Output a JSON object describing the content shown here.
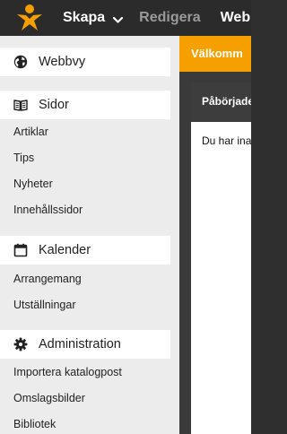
{
  "topbar": {
    "logo_icon": "person-star-logo-icon",
    "create_label": "Skapa",
    "create_icon": "chevron-down-icon",
    "edit_label": "Redigera",
    "web_label": "Webb",
    "logo_color": "#f5a000"
  },
  "sidebar": {
    "sections": [
      {
        "title": "Webbvy",
        "icon": "globe-icon",
        "items": []
      },
      {
        "title": "Sidor",
        "icon": "open-book-icon",
        "items": [
          {
            "label": "Artiklar"
          },
          {
            "label": "Tips"
          },
          {
            "label": "Nyheter"
          },
          {
            "label": "Innehållssidor"
          }
        ]
      },
      {
        "title": "Kalender",
        "icon": "calendar-icon",
        "items": [
          {
            "label": "Arrangemang"
          },
          {
            "label": "Utställningar"
          }
        ]
      },
      {
        "title": "Administration",
        "icon": "gear-icon",
        "items": [
          {
            "label": "Importera katalogpost"
          },
          {
            "label": "Omslagsbilder"
          },
          {
            "label": "Bibliotek"
          }
        ]
      }
    ]
  },
  "main": {
    "welcome_title": "Välkomm",
    "panel_header": "Påbörjade",
    "panel_text": "Du har ina",
    "accent_color": "#f5a000"
  }
}
